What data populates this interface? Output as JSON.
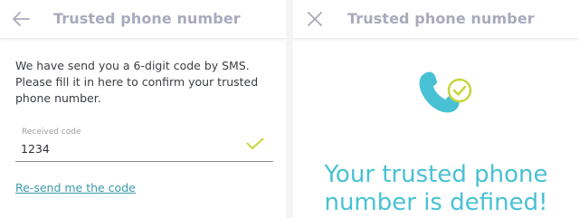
{
  "left_screen": {
    "header": {
      "title": "Trusted phone number",
      "icon": "back-arrow-icon"
    },
    "instruction": "We have send you a 6-digit code by SMS. Please fill it in here to confirm your trusted phone number.",
    "code_field": {
      "label": "Received code",
      "value": "1234",
      "status_icon": "check-icon"
    },
    "resend_link": "Re-send me the code"
  },
  "right_screen": {
    "header": {
      "title": "Trusted phone number",
      "icon": "close-icon"
    },
    "graphic": "phone-with-check-icon",
    "success_message": "Your trusted phone number is defined!"
  },
  "colors": {
    "header_title": "#a9aabd",
    "accent_teal": "#48c1d4",
    "check_lime": "#c6d63a",
    "link": "#3a9aa8",
    "text": "#3b3d44"
  }
}
